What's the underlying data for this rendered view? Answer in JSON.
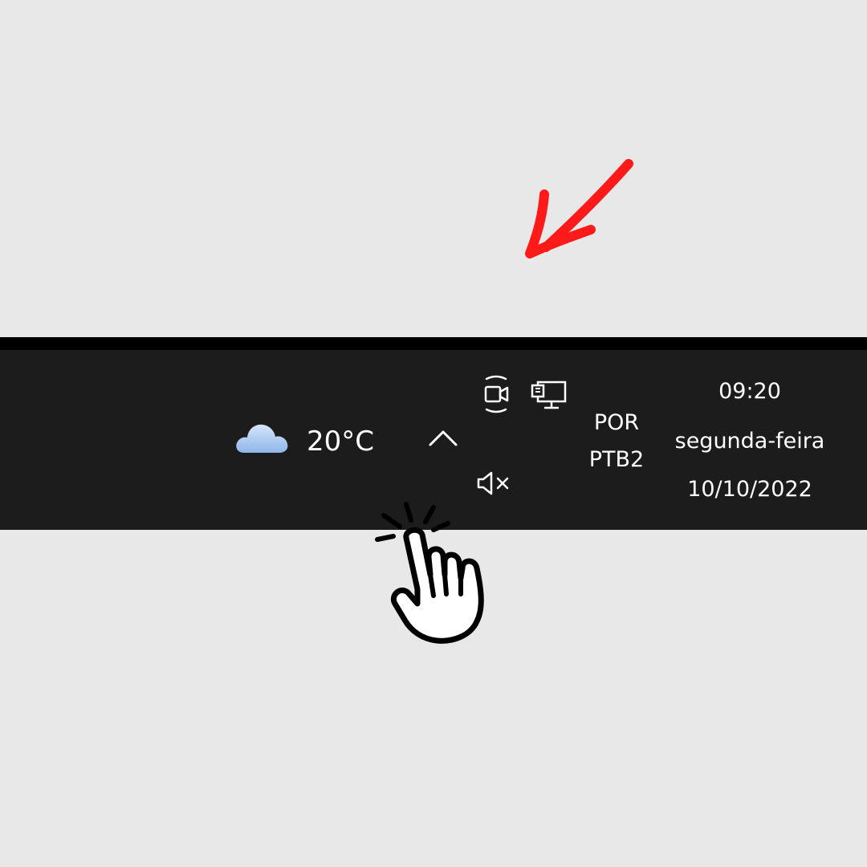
{
  "annotation": {
    "arrow_color": "#ff1a1a",
    "arrow_icon": "red-arrow-pointing-down-left-icon",
    "cursor_icon": "hand-pointer-click-icon"
  },
  "taskbar": {
    "background": "#1c1c1c",
    "weather": {
      "icon": "cloud-icon",
      "temperature": "20°C"
    },
    "show_hidden_icons": {
      "icon": "chevron-up-icon"
    },
    "tray": {
      "meet_icon": "meet-now-camera-icon",
      "network_icon": "network-monitor-icon",
      "volume_icon": "volume-muted-icon"
    },
    "language": {
      "line1": "POR",
      "line2": "PTB2"
    },
    "clock": {
      "time": "09:20",
      "day": "segunda-feira",
      "date": "10/10/2022"
    }
  }
}
